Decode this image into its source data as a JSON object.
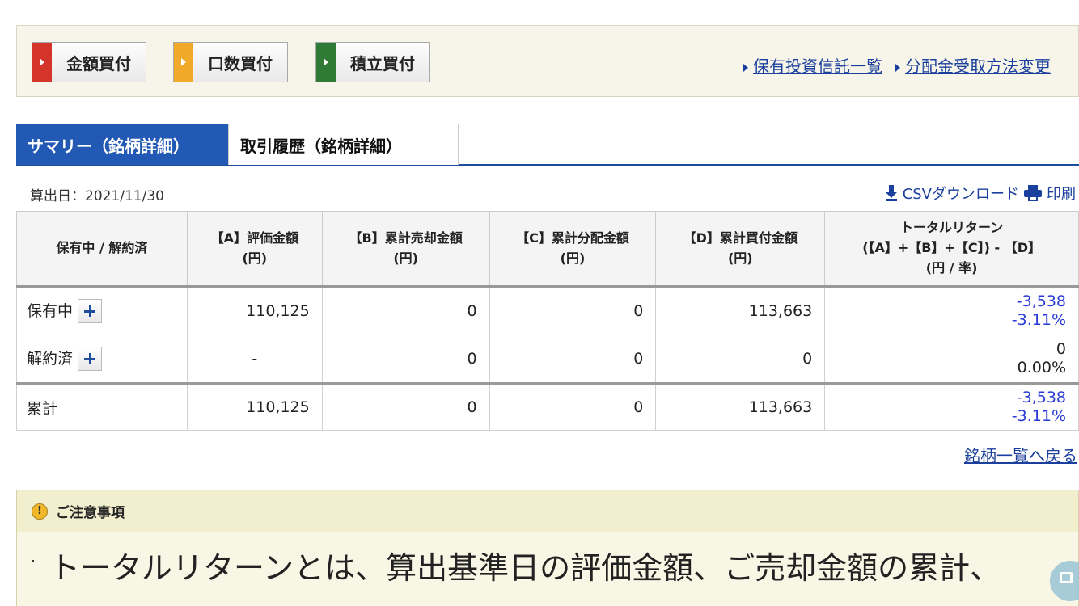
{
  "action_bar": {
    "buttons": [
      "金額買付",
      "口数買付",
      "積立買付"
    ],
    "links": [
      "保有投資信託一覧",
      "分配金受取方法変更"
    ]
  },
  "tabs": [
    "サマリー（銘柄詳細）",
    "取引履歴（銘柄詳細）"
  ],
  "calc_date": "算出日：2021/11/30",
  "utility_links": {
    "csv": "CSVダウンロード",
    "print": "印刷"
  },
  "table": {
    "headers": [
      [
        "保有中 / 解約済"
      ],
      [
        "【A】評価金額",
        "(円)"
      ],
      [
        "【B】累計売却金額",
        "(円)"
      ],
      [
        "【C】累計分配金額",
        "(円)"
      ],
      [
        "【D】累計買付金額",
        "(円)"
      ],
      [
        "トータルリターン",
        "(【A】+【B】+【C】) - 【D】",
        "(円 / 率)"
      ]
    ],
    "rows": [
      {
        "label": "保有中",
        "a": "110,125",
        "b": "0",
        "c": "0",
        "d": "113,663",
        "ret_amount": "-3,538",
        "ret_rate": "-3.11%"
      },
      {
        "label": "解約済",
        "a": "-",
        "b": "0",
        "c": "0",
        "d": "0",
        "ret_amount": "0",
        "ret_rate": "0.00%"
      },
      {
        "label": "累計",
        "a": "110,125",
        "b": "0",
        "c": "0",
        "d": "113,663",
        "ret_amount": "-3,538",
        "ret_rate": "-3.11%"
      }
    ]
  },
  "back_link": "銘柄一覧へ戻る",
  "notice": {
    "title": "ご注意事項",
    "body": "トータルリターンとは、算出基準日の評価金額、ご売却金額の累計、"
  },
  "colors": {
    "accent": "#2259b5",
    "link": "#1a3f9c",
    "negative": "#2b3bd6"
  }
}
